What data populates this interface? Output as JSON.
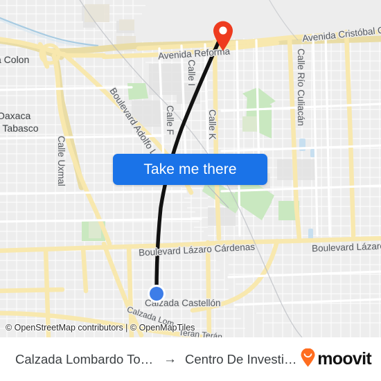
{
  "map": {
    "attribution": "© OpenStreetMap contributors | © OpenMapTiles",
    "cta_label": "Take me there",
    "background_color": "#ededed",
    "road_color": "#f8e8ae",
    "park_color": "#c9e8c0",
    "water_color": "#b8d4e8",
    "route_color": "#111111",
    "destination_pin_color": "#ee3b1f",
    "origin_dot_color": "#3d7de8",
    "accent_color": "#1a73e8",
    "labels": [
      {
        "id": "colon",
        "text": "a Colon"
      },
      {
        "id": "oaxaca",
        "text": "Oaxaca"
      },
      {
        "id": "tabasco",
        "text": "a Tabasco"
      },
      {
        "id": "calle-uxmal",
        "text": "Calle Uxmal"
      },
      {
        "id": "blvd-adolfo-lopez",
        "text": "Boulevard Adolfo López"
      },
      {
        "id": "avenida-reforma",
        "text": "Avenida Reforma"
      },
      {
        "id": "avenida-cristobal",
        "text": "Avenida Cristóbal Coló"
      },
      {
        "id": "calle-i",
        "text": "Calle I"
      },
      {
        "id": "calle-f",
        "text": "Calle F"
      },
      {
        "id": "calle-k",
        "text": "Calle K"
      },
      {
        "id": "calle-rio-culiacan",
        "text": "Calle Río Culiacán"
      },
      {
        "id": "blvd-lazaro-left",
        "text": "Boulevard Lázaro Cárdenas"
      },
      {
        "id": "blvd-lazaro-right",
        "text": "Boulevard Lázaro Ca"
      },
      {
        "id": "calzada-castellon",
        "text": "Calzada Castellón"
      },
      {
        "id": "calzada-lombardo",
        "text": "Calzada Lom"
      },
      {
        "id": "teran-teran",
        "text": "Terán Terán"
      }
    ]
  },
  "footer": {
    "origin": "Calzada Lombardo Toleda...",
    "arrow": "→",
    "destination": "Centro De Investigac...",
    "brand": "moovit"
  }
}
